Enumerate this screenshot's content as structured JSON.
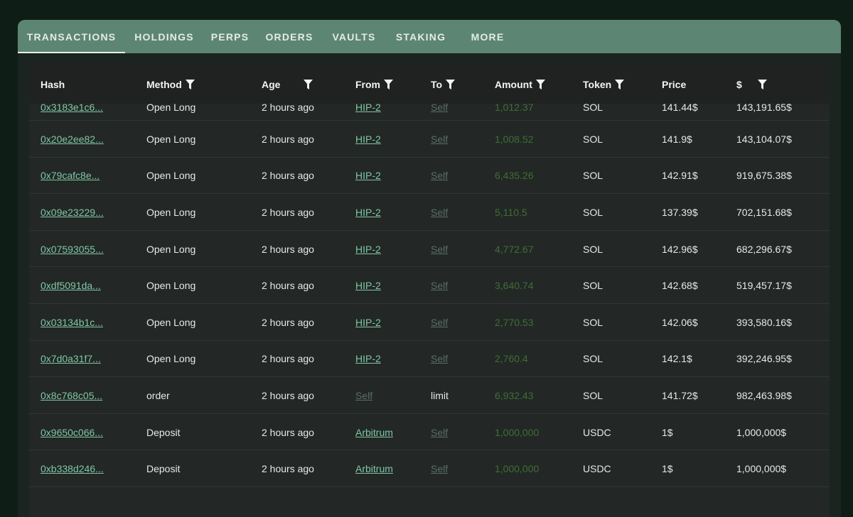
{
  "tabs": [
    {
      "label": "TRANSACTIONS",
      "active": true
    },
    {
      "label": "HOLDINGS",
      "active": false
    },
    {
      "label": "PERPS",
      "active": false
    },
    {
      "label": "ORDERS",
      "active": false
    },
    {
      "label": "VAULTS",
      "active": false
    },
    {
      "label": "STAKING",
      "active": false
    },
    {
      "label": "MORE",
      "active": false
    }
  ],
  "table": {
    "columns": [
      {
        "label": "Hash",
        "filter": false
      },
      {
        "label": "Method",
        "filter": true
      },
      {
        "label": "Age",
        "filter": true
      },
      {
        "label": "From",
        "filter": true
      },
      {
        "label": "To",
        "filter": true
      },
      {
        "label": "Amount",
        "filter": true
      },
      {
        "label": "Token",
        "filter": true
      },
      {
        "label": "Price",
        "filter": false
      },
      {
        "label": "$",
        "filter": true
      }
    ],
    "rows": [
      {
        "hash": "0x3183e1c6...",
        "method": "Open Long",
        "age": "2 hours ago",
        "from": "HIP-2",
        "to": "Self",
        "amount": "1,012.37",
        "token": "SOL",
        "price": "141.44$",
        "usd": "143,191.65$"
      },
      {
        "hash": "0x20e2ee82...",
        "method": "Open Long",
        "age": "2 hours ago",
        "from": "HIP-2",
        "to": "Self",
        "amount": "1,008.52",
        "token": "SOL",
        "price": "141.9$",
        "usd": "143,104.07$"
      },
      {
        "hash": "0x79cafc8e...",
        "method": "Open Long",
        "age": "2 hours ago",
        "from": "HIP-2",
        "to": "Self",
        "amount": "6,435.26",
        "token": "SOL",
        "price": "142.91$",
        "usd": "919,675.38$"
      },
      {
        "hash": "0x09e23229...",
        "method": "Open Long",
        "age": "2 hours ago",
        "from": "HIP-2",
        "to": "Self",
        "amount": "5,110.5",
        "token": "SOL",
        "price": "137.39$",
        "usd": "702,151.68$"
      },
      {
        "hash": "0x07593055...",
        "method": "Open Long",
        "age": "2 hours ago",
        "from": "HIP-2",
        "to": "Self",
        "amount": "4,772.67",
        "token": "SOL",
        "price": "142.96$",
        "usd": "682,296.67$"
      },
      {
        "hash": "0xdf5091da...",
        "method": "Open Long",
        "age": "2 hours ago",
        "from": "HIP-2",
        "to": "Self",
        "amount": "3,640.74",
        "token": "SOL",
        "price": "142.68$",
        "usd": "519,457.17$"
      },
      {
        "hash": "0x03134b1c...",
        "method": "Open Long",
        "age": "2 hours ago",
        "from": "HIP-2",
        "to": "Self",
        "amount": "2,770.53",
        "token": "SOL",
        "price": "142.06$",
        "usd": "393,580.16$"
      },
      {
        "hash": "0x7d0a31f7...",
        "method": "Open Long",
        "age": "2 hours ago",
        "from": "HIP-2",
        "to": "Self",
        "amount": "2,760.4",
        "token": "SOL",
        "price": "142.1$",
        "usd": "392,246.95$"
      },
      {
        "hash": "0x8c768c05...",
        "method": "order",
        "age": "2 hours ago",
        "from": "Self",
        "to": "limit",
        "amount": "6,932.43",
        "token": "SOL",
        "price": "141.72$",
        "usd": "982,463.98$"
      },
      {
        "hash": "0x9650c066...",
        "method": "Deposit",
        "age": "2 hours ago",
        "from": "Arbitrum",
        "to": "Self",
        "amount": "1,000,000",
        "token": "USDC",
        "price": "1$",
        "usd": "1,000,000$"
      },
      {
        "hash": "0xb338d246...",
        "method": "Deposit",
        "age": "2 hours ago",
        "from": "Arbitrum",
        "to": "Self",
        "amount": "1,000,000",
        "token": "USDC",
        "price": "1$",
        "usd": "1,000,000$"
      }
    ]
  },
  "icons": {
    "filter": "filter-funnel-icon"
  },
  "colors": {
    "tab_bar": "#5d8573",
    "link": "#7fc7a5",
    "amount": "#3f6e34",
    "muted_link": "#5b6e66"
  }
}
